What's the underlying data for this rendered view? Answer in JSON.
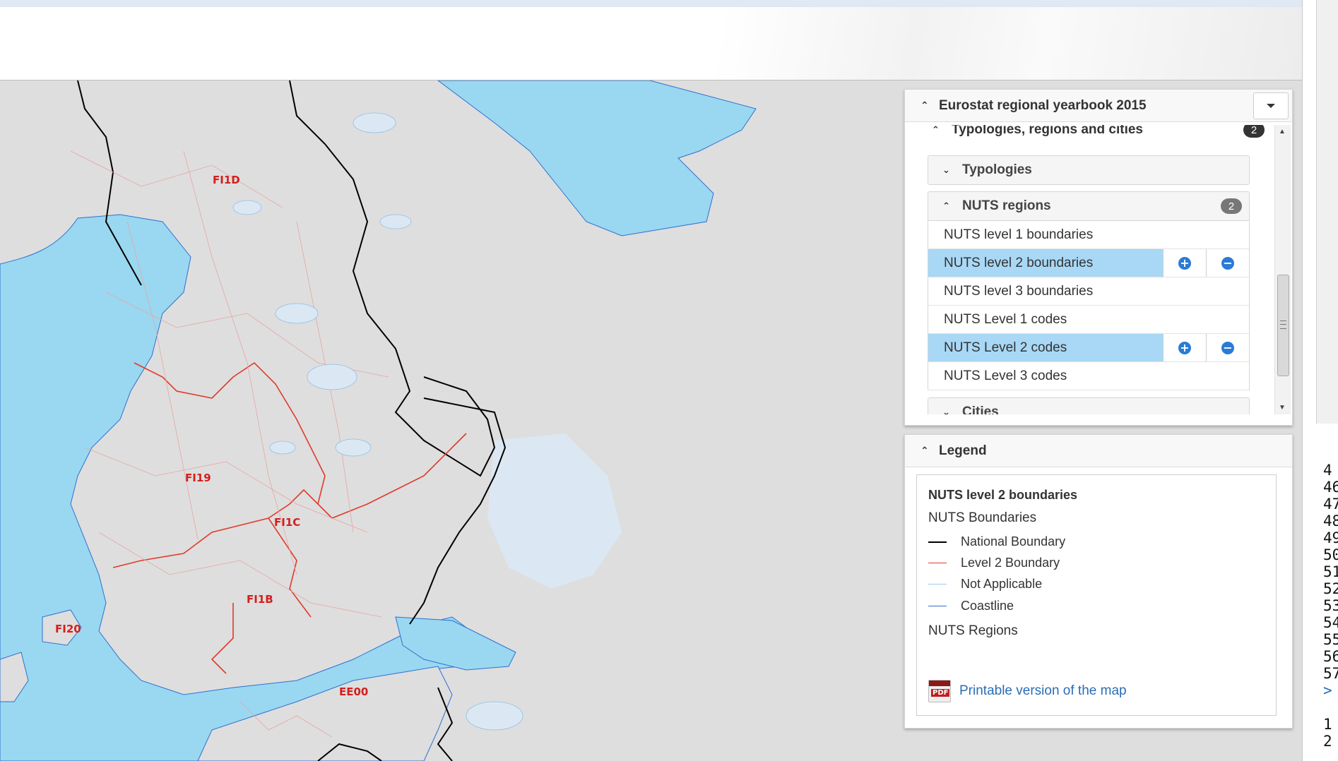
{
  "map": {
    "labels": {
      "fi1d": "FI1D",
      "fi19": "FI19",
      "fi1c": "FI1C",
      "fi1b": "FI1B",
      "fi20": "FI20",
      "ee00": "EE00"
    }
  },
  "layers_panel": {
    "title": "Eurostat regional yearbook 2015",
    "section": {
      "label": "Typologies, regions and cities",
      "badge": "2"
    },
    "typologies": {
      "label": "Typologies"
    },
    "nuts": {
      "label": "NUTS regions",
      "badge": "2",
      "layers": [
        {
          "name": "NUTS level 1 boundaries",
          "active": false
        },
        {
          "name": "NUTS level 2 boundaries",
          "active": true
        },
        {
          "name": "NUTS level 3 boundaries",
          "active": false
        },
        {
          "name": "NUTS Level 1 codes",
          "active": false
        },
        {
          "name": "NUTS Level 2 codes",
          "active": true
        },
        {
          "name": "NUTS Level 3 codes",
          "active": false
        }
      ]
    },
    "cities": {
      "label": "Cities"
    }
  },
  "legend": {
    "title": "Legend",
    "layer_title": "NUTS level 2 boundaries",
    "boundaries_heading": "NUTS Boundaries",
    "items": [
      {
        "label": "National Boundary",
        "color": "#000000"
      },
      {
        "label": "Level 2 Boundary",
        "color": "#e03a2a"
      },
      {
        "label": "Not Applicable",
        "color": "#9fc9ea"
      },
      {
        "label": "Coastline",
        "color": "#2f6fd0"
      }
    ],
    "regions_heading": "NUTS Regions",
    "pdf_link": "Printable version of the map"
  },
  "right_edge": {
    "numbers": [
      "4",
      "46",
      "47",
      "48",
      "49",
      "50",
      "51",
      "52",
      "53",
      "54",
      "55",
      "56",
      "57",
      ">",
      "1",
      "2"
    ]
  },
  "colors": {
    "sea": "#99d8f0",
    "lake": "#dbe8f3",
    "land": "#dedede",
    "active_layer": "#a8d8f5",
    "link": "#2a6db5"
  }
}
